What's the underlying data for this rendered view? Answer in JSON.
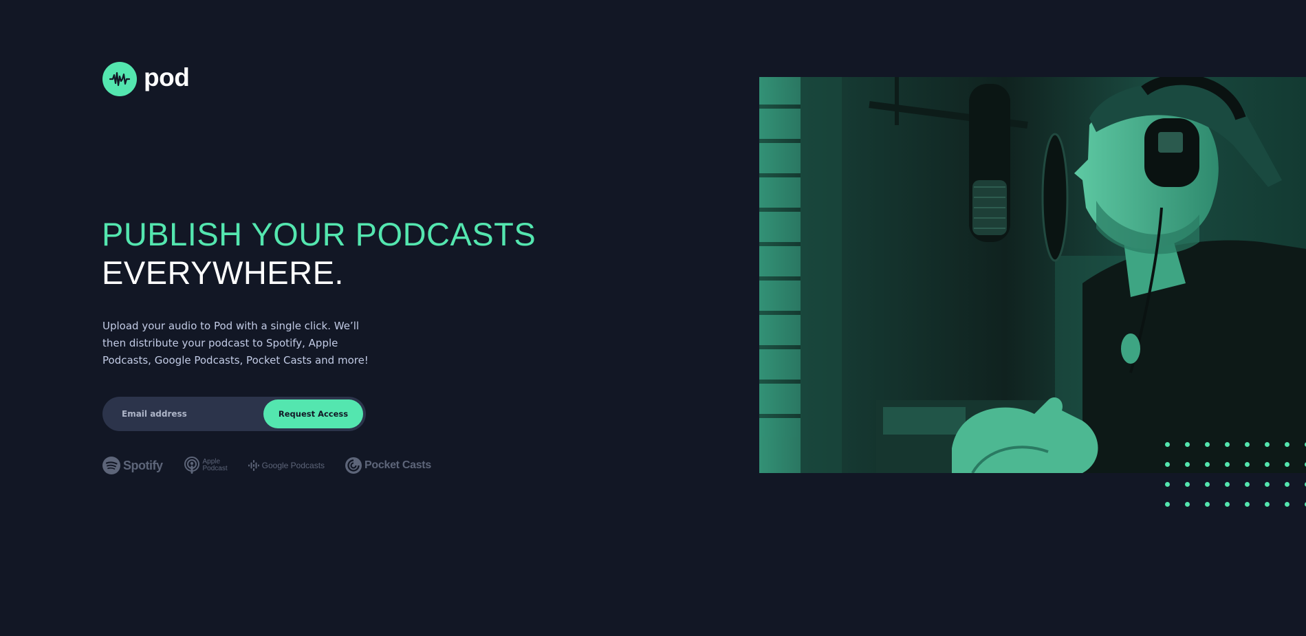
{
  "brand": {
    "name": "pod",
    "logo_icon": "waveform-icon",
    "accent": "#54e6af",
    "background": "#121725"
  },
  "hero": {
    "heading_line1": "PUBLISH YOUR PODCASTS",
    "heading_line2": "EVERYWHERE.",
    "description": "Upload your audio to Pod with a single click. We’ll then distribute your podcast to Spotify, Apple Podcasts, Google Podcasts, Pocket Casts and more!",
    "image": "podcaster-recording-with-microphone-and-headphones"
  },
  "form": {
    "email_placeholder": "Email address",
    "submit_label": "Request Access"
  },
  "platforms": {
    "spotify": "Spotify",
    "apple_line1": "Apple",
    "apple_line2": "Podcast",
    "google": "Google Podcasts",
    "pocket": "Pocket Casts"
  },
  "decoration": {
    "dots_pattern": "dot-grid"
  }
}
